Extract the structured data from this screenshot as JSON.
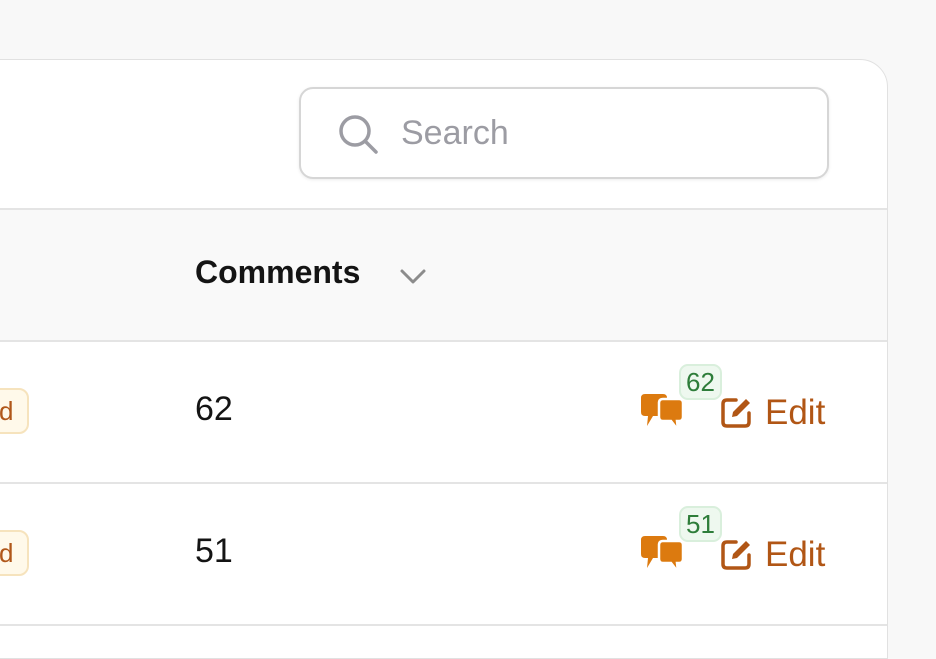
{
  "search": {
    "placeholder": "Search",
    "value": ""
  },
  "table": {
    "columns": {
      "comments": "Comments"
    },
    "rows": [
      {
        "status_fragment": "d",
        "comments": "62",
        "comment_count_badge": "62",
        "edit_label": "Edit"
      },
      {
        "status_fragment": "d",
        "comments": "51",
        "comment_count_badge": "51",
        "edit_label": "Edit"
      }
    ]
  },
  "icons": {
    "search": "search-icon",
    "sort": "chevron-down-icon",
    "comments": "comments-icon",
    "edit": "edit-icon"
  },
  "colors": {
    "accent": "#b15615",
    "comment_icon": "#dc7a0f",
    "count_badge_text": "#2e7d3a",
    "status_badge_bg": "#fff9ea"
  }
}
